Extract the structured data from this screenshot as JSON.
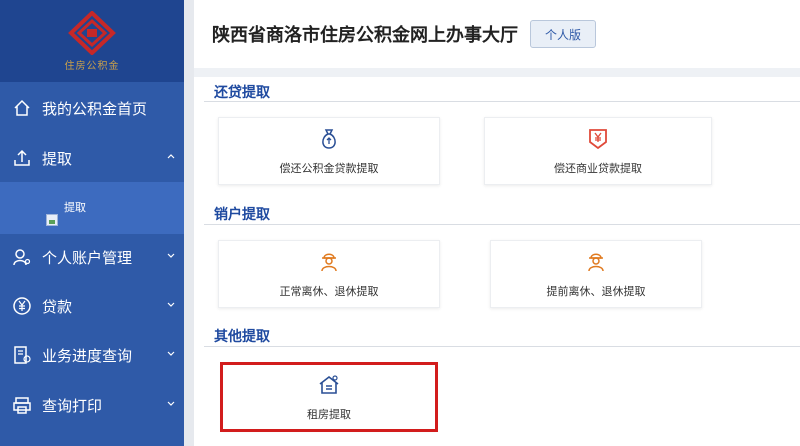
{
  "app": {
    "logo_text": "住房公积金",
    "title": "陕西省商洛市住房公积金网上办事大厅",
    "version_label": "个人版"
  },
  "sidebar": {
    "items": [
      {
        "label": "我的公积金首页",
        "icon": "home-icon"
      },
      {
        "label": "提取",
        "icon": "upload-icon",
        "expanded": true
      },
      {
        "label": "个人账户管理",
        "icon": "user-settings-icon"
      },
      {
        "label": "贷款",
        "icon": "yen-coin-icon"
      },
      {
        "label": "业务进度查询",
        "icon": "progress-doc-icon"
      },
      {
        "label": "查询打印",
        "icon": "printer-icon"
      }
    ],
    "sub_items": [
      {
        "label": "提取",
        "icon": "broken-image-icon"
      }
    ]
  },
  "sections": [
    {
      "title": "还贷提取",
      "cards": [
        {
          "label": "偿还公积金贷款提取",
          "icon": "money-bag-icon"
        },
        {
          "label": "偿还商业贷款提取",
          "icon": "yen-badge-icon"
        }
      ]
    },
    {
      "title": "销户提取",
      "cards": [
        {
          "label": "正常离休、退休提取",
          "icon": "retiree-icon"
        },
        {
          "label": "提前离休、退休提取",
          "icon": "retiree-icon"
        }
      ]
    },
    {
      "title": "其他提取",
      "cards": [
        {
          "label": "租房提取",
          "icon": "rent-house-icon"
        }
      ]
    }
  ],
  "colors": {
    "sidebar_bg": "#2f5aa8",
    "accent": "#1f4aa0",
    "highlight": "#d21c1c",
    "icon_orange": "#e07a1f",
    "icon_red": "#e04a3a"
  }
}
